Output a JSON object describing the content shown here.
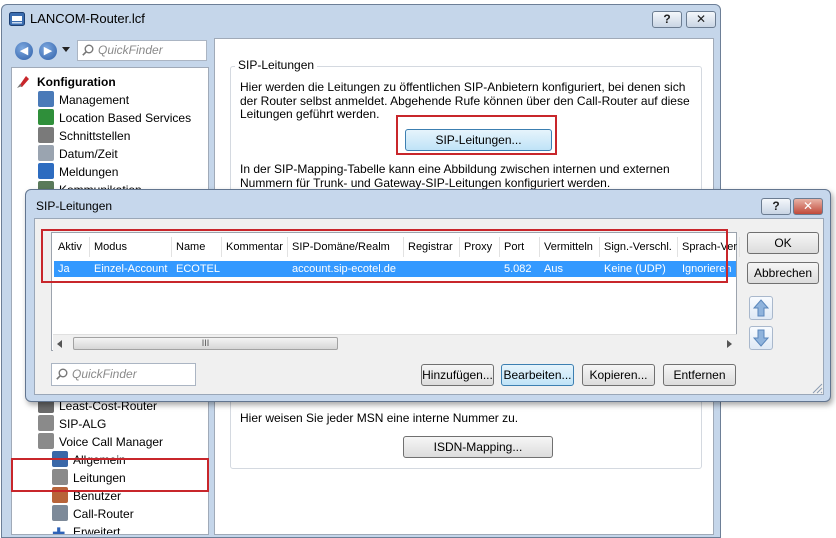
{
  "window": {
    "title": "LANCOM-Router.lcf",
    "help_label": "?",
    "close_label": "✕"
  },
  "toolbar": {
    "quickfinder_placeholder": "QuickFinder"
  },
  "tree": {
    "root_label": "Konfiguration",
    "top_items": [
      {
        "label": "Management",
        "icon": "management-icon"
      },
      {
        "label": "Location Based Services",
        "icon": "location-icon"
      },
      {
        "label": "Schnittstellen",
        "icon": "interfaces-icon"
      },
      {
        "label": "Datum/Zeit",
        "icon": "clock-icon"
      },
      {
        "label": "Meldungen",
        "icon": "info-icon"
      },
      {
        "label": "Kommunikation",
        "icon": "communication-icon"
      }
    ],
    "bottom_items": [
      {
        "label": "Least-Cost-Router",
        "icon": "lcr-icon",
        "indent": 0
      },
      {
        "label": "SIP-ALG",
        "icon": "phone-icon",
        "indent": 0
      },
      {
        "label": "Voice Call Manager",
        "icon": "phone-icon",
        "indent": 0
      },
      {
        "label": "Allgemein",
        "icon": "general-icon",
        "indent": 1
      },
      {
        "label": "Leitungen",
        "icon": "phone-icon",
        "indent": 1,
        "selected": true
      },
      {
        "label": "Benutzer",
        "icon": "user-icon",
        "indent": 1
      },
      {
        "label": "Call-Router",
        "icon": "router-icon",
        "indent": 1
      },
      {
        "label": "Erweitert",
        "icon": "plus-icon",
        "indent": 1
      }
    ]
  },
  "content": {
    "sip_group_label": "SIP-Leitungen",
    "sip_description": "Hier werden die Leitungen zu öffentlichen SIP-Anbietern konfiguriert, bei denen sich der Router selbst anmeldet. Abgehende Rufe können über den Call-Router auf diese Leitungen geführt werden.",
    "sip_button_label": "SIP-Leitungen...",
    "mapping_description": "In der SIP-Mapping-Tabelle kann eine Abbildung zwischen internen und externen Nummern für Trunk- und Gateway-SIP-Leitungen konfiguriert werden.",
    "isdn_description": "Hier weisen Sie jeder MSN eine interne Nummer zu.",
    "isdn_button_label": "ISDN-Mapping..."
  },
  "dialog": {
    "title": "SIP-Leitungen",
    "help_label": "?",
    "close_label": "✕",
    "columns": [
      "Aktiv",
      "Modus",
      "Name",
      "Kommentar",
      "SIP-Domäne/Realm",
      "Registrar",
      "Proxy",
      "Port",
      "Vermitteln",
      "Sign.-Verschl.",
      "Sprach-Ver"
    ],
    "rows": [
      [
        "Ja",
        "Einzel-Account",
        "ECOTEL",
        "",
        "account.sip-ecotel.de",
        "",
        "",
        "5.082",
        "Aus",
        "Keine (UDP)",
        "Ignorieren"
      ]
    ],
    "scroll_thumb_label": "III",
    "quickfinder_placeholder": "QuickFinder",
    "ok_label": "OK",
    "cancel_label": "Abbrechen",
    "add_label": "Hinzufügen...",
    "edit_label": "Bearbeiten...",
    "copy_label": "Kopieren...",
    "remove_label": "Entfernen"
  },
  "colors": {
    "highlight_red": "#c8262b",
    "selection_blue": "#3399ff",
    "window_frame": "#c5d6ea"
  }
}
